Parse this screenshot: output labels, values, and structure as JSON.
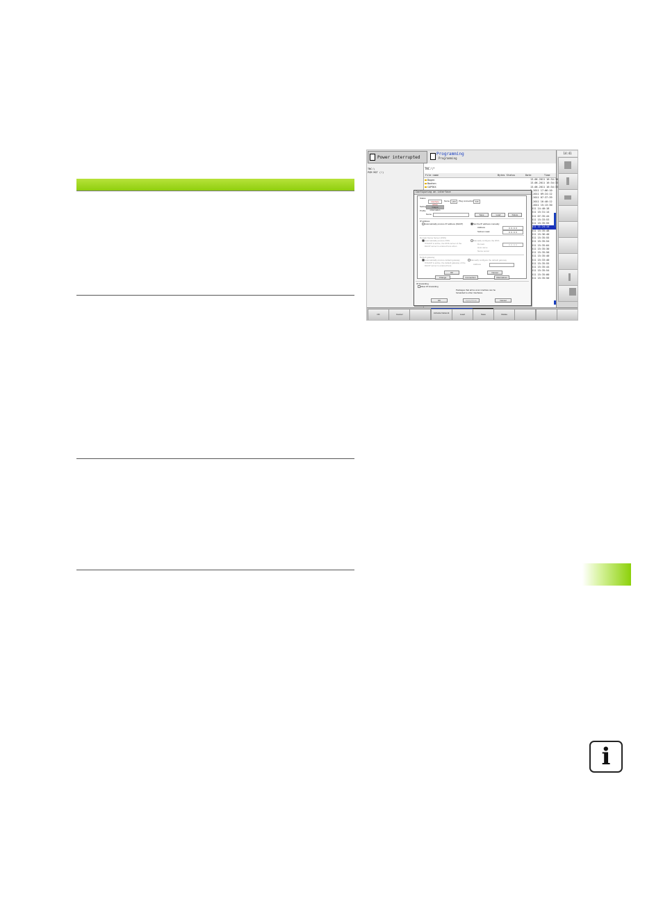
{
  "screen": {
    "header": {
      "mode_left": "Power interrupted",
      "mode_right_title": "Programming",
      "mode_right_sub": "Programming"
    },
    "clock": "14:41",
    "left_pane": {
      "line1": "TNC:\\",
      "line2": "PGM MGT (!)"
    },
    "file_manager": {
      "path": "TNC:\\*",
      "columns": {
        "name": "File name",
        "bytes": "Bytes Status",
        "date": "Date",
        "time": "Time"
      },
      "dirs": [
        "Bogen",
        "Boehen",
        "CAPSKX"
      ],
      "dates": [
        "13-06-2011 16:34:38",
        "13-06-2011 16:34:33",
        "13-06-2011 16:34:33",
        "5-2011 17:06:10",
        "5-2011 09:24:12",
        "5-2011 07:37:39",
        "5-2011 16:40:12",
        "5-2011 15:13:30",
        "2011 14:40:18",
        "2011 15:31:14",
        "2011 07:35:44",
        "2011 15:33:53",
        "2011 15:35:55",
        "2011 11:24:14",
        "2011 15:35:48",
        "2011 15:36:40",
        "2011 15:35:55",
        "2011 15:35:54",
        "2011 15:35:04",
        "2011 15:35:30",
        "2011 15:35:50",
        "2011 15:35:40",
        "2011 15:33:40",
        "2011 15:35:55",
        "2011 15:35:44",
        "2011 15:35:54",
        "2011 15:35:00",
        "2011 15:35:50"
      ],
      "selected_index": 13
    },
    "dialog": {
      "title": "Configuring an interface",
      "status_label": "Status",
      "status_value": "Interface active",
      "name_label": "Name",
      "name_value": "eth0",
      "plug_label": "Plug connection",
      "plug_value": "X26",
      "setting_label": "Setting",
      "setting_value": "Output information",
      "profile_label": "Profile",
      "profile_name_label": "Name",
      "btn_save": "Save",
      "btn_load": "Load",
      "btn_delete": "Delete",
      "ip_group": "IP address",
      "ip_auto": "Automatically procure IP address (DHCP)",
      "ip_manual": "Set the IP address manually",
      "address_label": "Address",
      "address_value": "0. 0. 0. 0",
      "subnet_label": "Subnet mask",
      "subnet_value": "0. 0. 0. 0",
      "dns_group": "Domain Name Server (DNS)",
      "dns_auto": "Automatically procure DNS",
      "dns_manual": "Manually configure the DNS",
      "dns_note": "If DHCP is active, the DNS server of the DHCP server is entered here when",
      "dns_domain": "Domain",
      "dns_host": "Host name",
      "dns_server": "Name server",
      "dns_server_value": "0. 0. 0. 0",
      "gw_group": "Default gateway",
      "gw_auto": "Automatically procure default gateway",
      "gw_manual": "Manually configure the default gateway",
      "gw_note": "If DHCP is active, the default gateway of the DHCP server is entered here",
      "gw_address": "Address",
      "btn_ok_inner": "OK",
      "btn_cancel_inner": "Cancel",
      "btn_change": "Change",
      "btn_connection": "Connection",
      "btn_alternative": "Alternatives",
      "fwd_group": "IP forwarding",
      "fwd_allow": "Allow IP forwarding",
      "fwd_note": "Packages that arrive at an interface can be forwarded to other interfaces.",
      "btn_ok": "OK",
      "btn_apply": "Apply/Close",
      "btn_cancel": "Cancel"
    },
    "softkeys": [
      "OK",
      "Cancel",
      "",
      "Activate Network",
      "Load",
      "Save",
      "Delete",
      "",
      "",
      ""
    ]
  },
  "page": {
    "info_icon_glyph": "i",
    "accent_green": "#8cd10a"
  }
}
